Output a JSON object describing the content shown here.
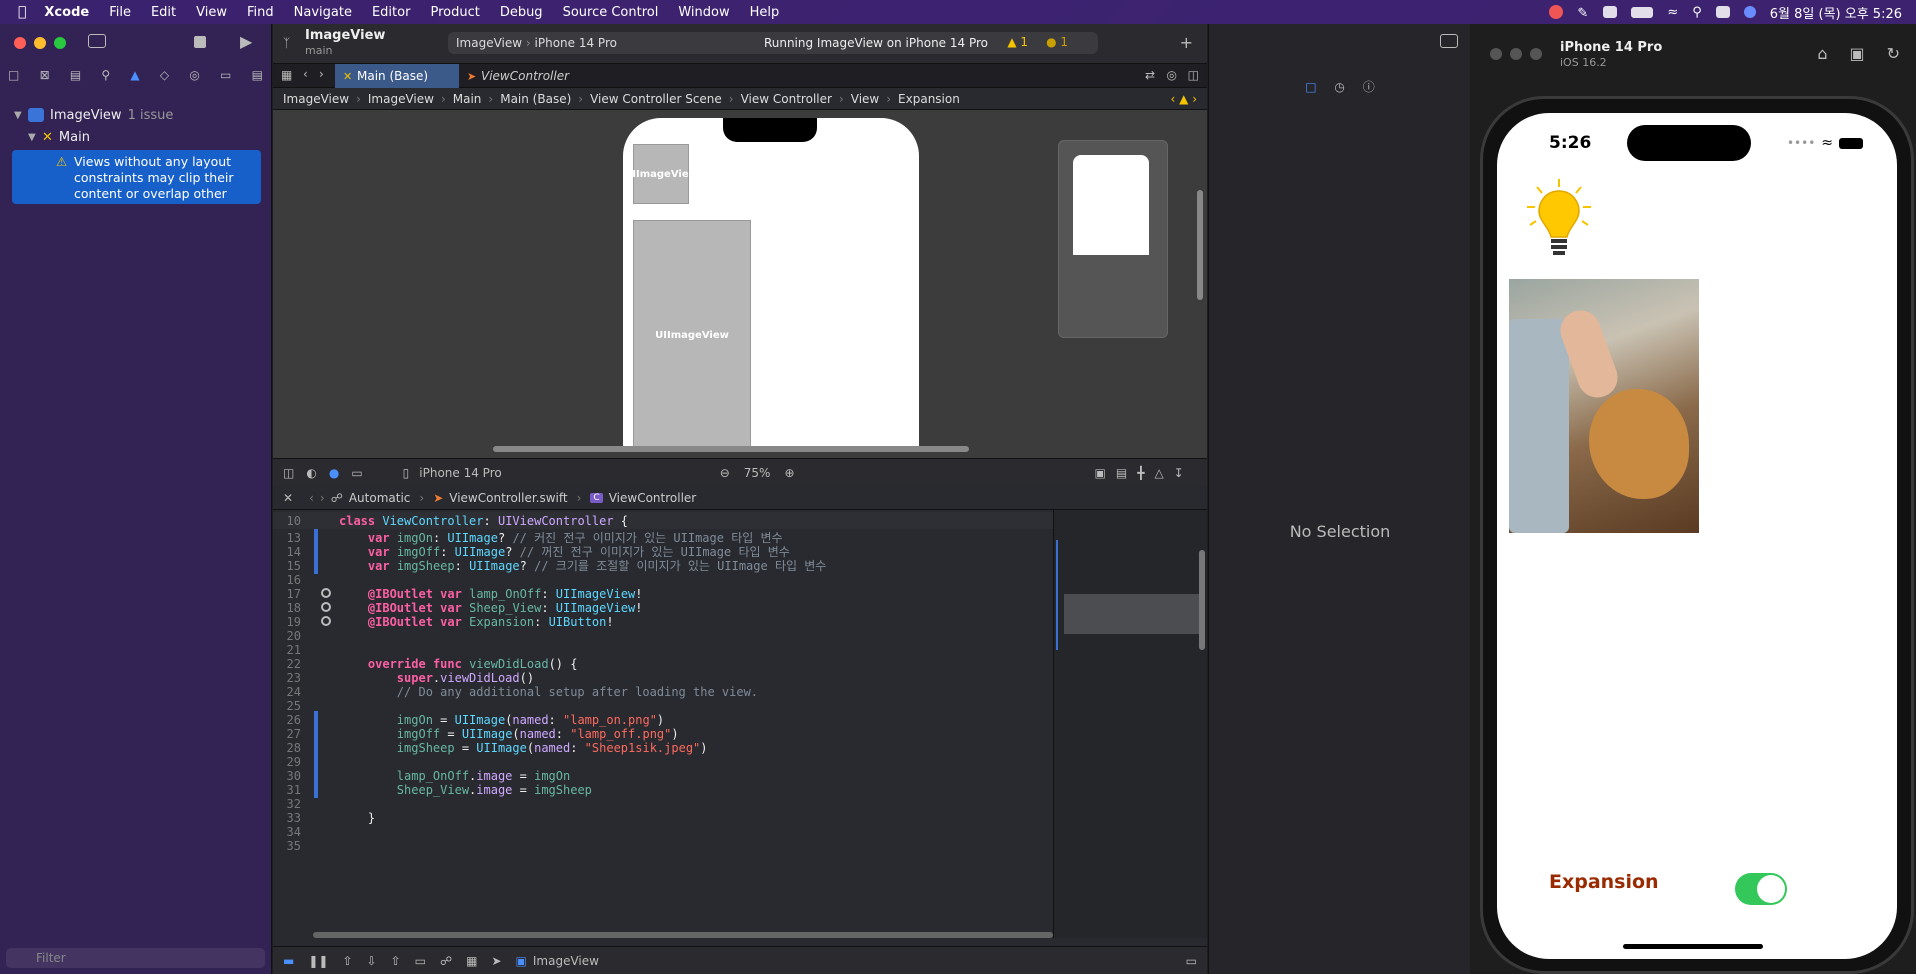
{
  "menubar": {
    "app": "Xcode",
    "items": [
      "File",
      "Edit",
      "View",
      "Find",
      "Navigate",
      "Editor",
      "Product",
      "Debug",
      "Source Control",
      "Window",
      "Help"
    ],
    "datetime": "6월 8일 (목) 오후 5:26"
  },
  "navigator": {
    "project": "ImageView",
    "issue_count": "1 issue",
    "group": "Main",
    "issue_text": "Views without any layout constraints may clip their content or overlap other vie...",
    "filter_placeholder": "Filter"
  },
  "toolbar": {
    "project": "ImageView",
    "branch": "main",
    "scheme": "ImageView",
    "device": "iPhone 14 Pro",
    "status": "Running ImageView on iPhone 14 Pro",
    "warnings": "1",
    "runtime_warnings": "1"
  },
  "tabs": [
    {
      "label": "Main (Base)",
      "active": true
    },
    {
      "label": "ViewController",
      "active": false
    }
  ],
  "jumpbar": [
    "ImageView",
    "ImageView",
    "Main",
    "Main (Base)",
    "View Controller Scene",
    "View Controller",
    "View",
    "Expansion"
  ],
  "canvas": {
    "label_small": "UIImageView",
    "label_large": "UIImageView",
    "device": "iPhone 14 Pro",
    "zoom": "75%"
  },
  "code_jump": [
    "Automatic",
    "ViewController.swift",
    "ViewController"
  ],
  "code": {
    "header_line": "10",
    "lines": [
      {
        "n": "13",
        "parts": [
          [
            "pl",
            "    "
          ],
          [
            "kw",
            "var"
          ],
          [
            "pl",
            " "
          ],
          [
            "id",
            "imgOn"
          ],
          [
            "pl",
            ": "
          ],
          [
            "ty",
            "UIImage"
          ],
          [
            "pl",
            "? "
          ],
          [
            "cmt",
            "// 커진 전구 이미지가 있는 UIImage 타입 변수"
          ]
        ]
      },
      {
        "n": "14",
        "parts": [
          [
            "pl",
            "    "
          ],
          [
            "kw",
            "var"
          ],
          [
            "pl",
            " "
          ],
          [
            "id",
            "imgOff"
          ],
          [
            "pl",
            ": "
          ],
          [
            "ty",
            "UIImage"
          ],
          [
            "pl",
            "? "
          ],
          [
            "cmt",
            "// 꺼진 전구 이미지가 있는 UIImage 타입 변수"
          ]
        ]
      },
      {
        "n": "15",
        "parts": [
          [
            "pl",
            "    "
          ],
          [
            "kw",
            "var"
          ],
          [
            "pl",
            " "
          ],
          [
            "id",
            "imgSheep"
          ],
          [
            "pl",
            ": "
          ],
          [
            "ty",
            "UIImage"
          ],
          [
            "pl",
            "? "
          ],
          [
            "cmt",
            "// 크기를 조절할 이미지가 있는 UIImage 타입 변수"
          ]
        ]
      },
      {
        "n": "16",
        "parts": []
      },
      {
        "n": "17",
        "parts": [
          [
            "pl",
            "    "
          ],
          [
            "kw",
            "@IBOutlet"
          ],
          [
            "pl",
            " "
          ],
          [
            "kw",
            "var"
          ],
          [
            "pl",
            " "
          ],
          [
            "id",
            "lamp_OnOff"
          ],
          [
            "pl",
            ": "
          ],
          [
            "ty",
            "UIImageView"
          ],
          [
            "pl",
            "!"
          ]
        ]
      },
      {
        "n": "18",
        "parts": [
          [
            "pl",
            "    "
          ],
          [
            "kw",
            "@IBOutlet"
          ],
          [
            "pl",
            " "
          ],
          [
            "kw",
            "var"
          ],
          [
            "pl",
            " "
          ],
          [
            "id",
            "Sheep_View"
          ],
          [
            "pl",
            ": "
          ],
          [
            "ty",
            "UIImageView"
          ],
          [
            "pl",
            "!"
          ]
        ]
      },
      {
        "n": "19",
        "parts": [
          [
            "pl",
            "    "
          ],
          [
            "kw",
            "@IBOutlet"
          ],
          [
            "pl",
            " "
          ],
          [
            "kw",
            "var"
          ],
          [
            "pl",
            " "
          ],
          [
            "id",
            "Expansion"
          ],
          [
            "pl",
            ": "
          ],
          [
            "ty",
            "UIButton"
          ],
          [
            "pl",
            "!"
          ]
        ]
      },
      {
        "n": "20",
        "parts": []
      },
      {
        "n": "21",
        "parts": []
      },
      {
        "n": "22",
        "parts": [
          [
            "pl",
            "    "
          ],
          [
            "kw",
            "override"
          ],
          [
            "pl",
            " "
          ],
          [
            "kw",
            "func"
          ],
          [
            "pl",
            " "
          ],
          [
            "fn",
            "viewDidLoad"
          ],
          [
            "pl",
            "() {"
          ]
        ]
      },
      {
        "n": "23",
        "parts": [
          [
            "pl",
            "        "
          ],
          [
            "kw",
            "super"
          ],
          [
            "pl",
            "."
          ],
          [
            "ty2",
            "viewDidLoad"
          ],
          [
            "pl",
            "()"
          ]
        ]
      },
      {
        "n": "24",
        "parts": [
          [
            "pl",
            "        "
          ],
          [
            "cmt",
            "// Do any additional setup after loading the view."
          ]
        ]
      },
      {
        "n": "25",
        "parts": []
      },
      {
        "n": "26",
        "parts": [
          [
            "pl",
            "        "
          ],
          [
            "id",
            "imgOn"
          ],
          [
            "pl",
            " = "
          ],
          [
            "ty",
            "UIImage"
          ],
          [
            "pl",
            "("
          ],
          [
            "ty2",
            "named"
          ],
          [
            "pl",
            ": "
          ],
          [
            "str",
            "\"lamp_on.png\""
          ],
          [
            "pl",
            ")"
          ]
        ]
      },
      {
        "n": "27",
        "parts": [
          [
            "pl",
            "        "
          ],
          [
            "id",
            "imgOff"
          ],
          [
            "pl",
            " = "
          ],
          [
            "ty",
            "UIImage"
          ],
          [
            "pl",
            "("
          ],
          [
            "ty2",
            "named"
          ],
          [
            "pl",
            ": "
          ],
          [
            "str",
            "\"lamp_off.png\""
          ],
          [
            "pl",
            ")"
          ]
        ]
      },
      {
        "n": "28",
        "parts": [
          [
            "pl",
            "        "
          ],
          [
            "id",
            "imgSheep"
          ],
          [
            "pl",
            " = "
          ],
          [
            "ty",
            "UIImage"
          ],
          [
            "pl",
            "("
          ],
          [
            "ty2",
            "named"
          ],
          [
            "pl",
            ": "
          ],
          [
            "str",
            "\"Sheep1sik.jpeg\""
          ],
          [
            "pl",
            ")"
          ]
        ]
      },
      {
        "n": "29",
        "parts": []
      },
      {
        "n": "30",
        "parts": [
          [
            "pl",
            "        "
          ],
          [
            "id",
            "lamp_OnOff"
          ],
          [
            "pl",
            "."
          ],
          [
            "ty2",
            "image"
          ],
          [
            "pl",
            " = "
          ],
          [
            "id",
            "imgOn"
          ]
        ]
      },
      {
        "n": "31",
        "parts": [
          [
            "pl",
            "        "
          ],
          [
            "id",
            "Sheep_View"
          ],
          [
            "pl",
            "."
          ],
          [
            "ty2",
            "image"
          ],
          [
            "pl",
            " = "
          ],
          [
            "id",
            "imgSheep"
          ]
        ]
      },
      {
        "n": "32",
        "parts": []
      },
      {
        "n": "33",
        "parts": [
          [
            "pl",
            "    }"
          ]
        ]
      },
      {
        "n": "34",
        "parts": []
      },
      {
        "n": "35",
        "parts": []
      }
    ]
  },
  "debugbar": {
    "target": "ImageView"
  },
  "inspector": {
    "empty": "No Selection"
  },
  "simulator": {
    "title": "iPhone 14 Pro",
    "subtitle": "iOS 16.2",
    "time": "5:26",
    "button": "Expansion",
    "switch_on": true
  }
}
